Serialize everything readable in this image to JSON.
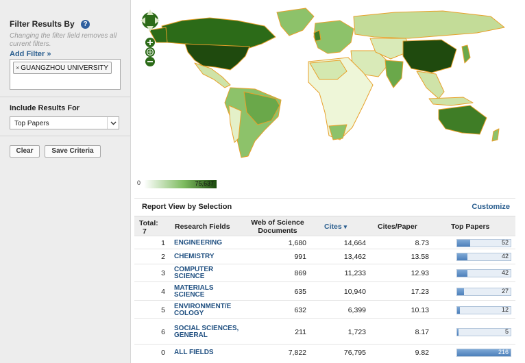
{
  "sidebar": {
    "filter_title": "Filter Results By",
    "help_icon": "?",
    "filter_note": "Changing the filter field removes all current filters.",
    "add_filter": "Add Filter »",
    "active_filter": {
      "remove_glyph": "×",
      "label": "GUANGZHOU UNIVERSITY"
    },
    "include_title": "Include Results For",
    "include_select": {
      "value": "Top Papers"
    },
    "buttons": {
      "clear": "Clear",
      "save": "Save Criteria"
    }
  },
  "map": {
    "legend_min": "0",
    "legend_max": "75,637",
    "colors": {
      "ocean": "#ffffff",
      "land_light": "#eef6d8",
      "land_mid": "#8dc26a",
      "land_dark": "#2c6b18",
      "border": "#e8a02a"
    },
    "controls": [
      "pan-control-icon",
      "zoom-in-icon",
      "globe-icon",
      "zoom-out-icon"
    ]
  },
  "report": {
    "title": "Report View by Selection",
    "customize": "Customize",
    "columns": {
      "total_label": "Total:",
      "total_value": "7",
      "field": "Research Fields",
      "docs": "Web of Science Documents",
      "cites": "Cites",
      "cites_sort_icon": "▾",
      "cpp": "Cites/Paper",
      "top": "Top Papers"
    },
    "bar_max": 216,
    "rows": [
      {
        "rank": "1",
        "field": "ENGINEERING",
        "docs": "1,680",
        "cites": "14,664",
        "cpp": "8.73",
        "top": "52",
        "top_value": 52
      },
      {
        "rank": "2",
        "field": "CHEMISTRY",
        "docs": "991",
        "cites": "13,462",
        "cpp": "13.58",
        "top": "42",
        "top_value": 42
      },
      {
        "rank": "3",
        "field": "COMPUTER SCIENCE",
        "docs": "869",
        "cites": "11,233",
        "cpp": "12.93",
        "top": "42",
        "top_value": 42
      },
      {
        "rank": "4",
        "field": "MATERIALS SCIENCE",
        "docs": "635",
        "cites": "10,940",
        "cpp": "17.23",
        "top": "27",
        "top_value": 27
      },
      {
        "rank": "5",
        "field": "ENVIRONMENT/E COLOGY",
        "docs": "632",
        "cites": "6,399",
        "cpp": "10.13",
        "top": "12",
        "top_value": 12
      },
      {
        "rank": "6",
        "field": "SOCIAL SCIENCES, GENERAL",
        "docs": "211",
        "cites": "1,723",
        "cpp": "8.17",
        "top": "5",
        "top_value": 5
      },
      {
        "rank": "0",
        "field": "ALL FIELDS",
        "docs": "7,822",
        "cites": "76,795",
        "cpp": "9.82",
        "top": "216",
        "top_value": 216
      }
    ]
  }
}
